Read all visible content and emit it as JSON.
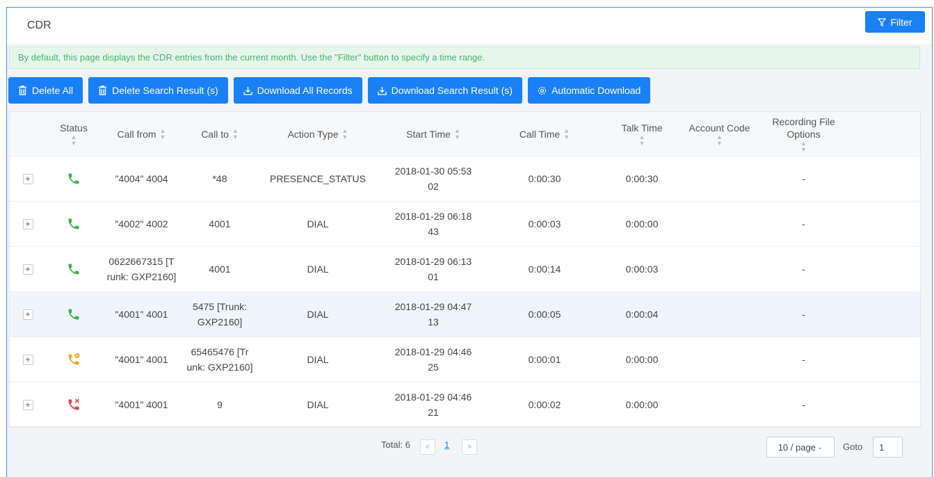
{
  "header": {
    "title": "CDR",
    "filter_label": "Filter"
  },
  "notice": "By default, this page displays the CDR entries from the current month. Use the \"Filter\" button to specify a time range.",
  "toolbar": {
    "delete_all": "Delete All",
    "delete_search": "Delete Search Result (s)",
    "download_all": "Download All Records",
    "download_search": "Download Search Result (s)",
    "automatic_download": "Automatic Download"
  },
  "columns": [
    "Status",
    "Call from",
    "Call to",
    "Action Type",
    "Start Time",
    "Call Time",
    "Talk Time",
    "Account Code",
    "Recording File Options"
  ],
  "rows": [
    {
      "status": "answered",
      "from": "\"4004\" 4004",
      "to": "*48",
      "action": "PRESENCE_STATUS",
      "start": "2018-01-30 05:53:02",
      "call_time": "0:00:30",
      "talk_time": "0:00:30",
      "account": "",
      "recording": "-"
    },
    {
      "status": "answered",
      "from": "\"4002\" 4002",
      "to": "4001",
      "action": "DIAL",
      "start": "2018-01-29 06:18:43",
      "call_time": "0:00:03",
      "talk_time": "0:00:00",
      "account": "",
      "recording": "-"
    },
    {
      "status": "answered",
      "from": "0622667315 [Trunk: GXP2160]",
      "to": "4001",
      "action": "DIAL",
      "start": "2018-01-29 06:13:01",
      "call_time": "0:00:14",
      "talk_time": "0:00:03",
      "account": "",
      "recording": "-"
    },
    {
      "status": "answered",
      "from": "\"4001\" 4001",
      "to": "5475 [Trunk: GXP2160]",
      "action": "DIAL",
      "start": "2018-01-29 04:47:13",
      "call_time": "0:00:05",
      "talk_time": "0:00:04",
      "account": "",
      "recording": "-"
    },
    {
      "status": "busy",
      "from": "\"4001\" 4001",
      "to": "65465476 [Trunk: GXP2160]",
      "action": "DIAL",
      "start": "2018-01-29 04:46:25",
      "call_time": "0:00:01",
      "talk_time": "0:00:00",
      "account": "",
      "recording": "-"
    },
    {
      "status": "failed",
      "from": "\"4001\" 4001",
      "to": "9",
      "action": "DIAL",
      "start": "2018-01-29 04:46:21",
      "call_time": "0:00:02",
      "talk_time": "0:00:00",
      "account": "",
      "recording": "-"
    }
  ],
  "pagination": {
    "total": "Total: 6",
    "current_page": "1",
    "page_size": "10 / page",
    "goto_label": "Goto",
    "goto_value": "1"
  },
  "colors": {
    "primary": "#1a80f5",
    "answered": "#3cb54a",
    "busy": "#f5a623",
    "failed": "#e0434b",
    "notice_text": "#44b46a"
  }
}
